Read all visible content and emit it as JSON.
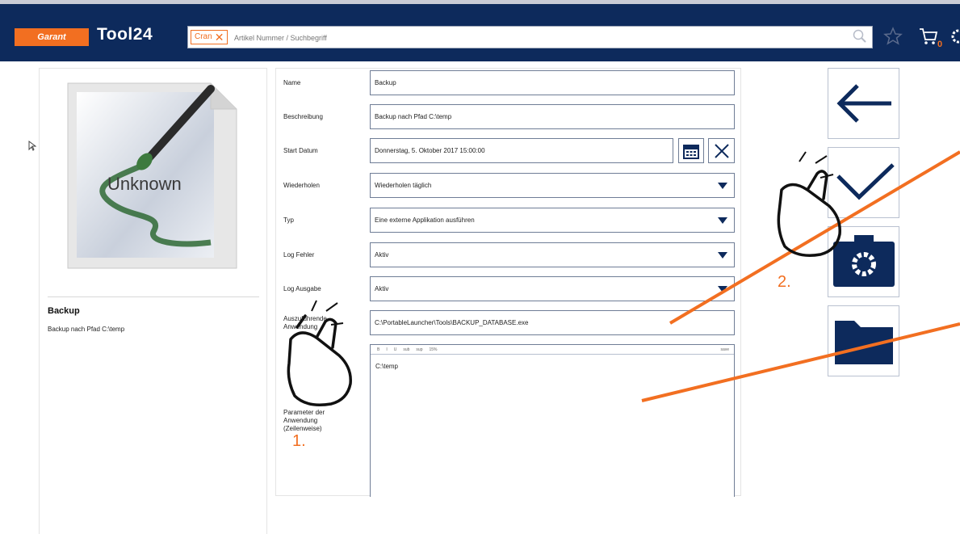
{
  "header": {
    "brand_logo": "Garant",
    "app_name": "Tool24",
    "search_tag": "Cran",
    "search_tag_close": "✕",
    "search_placeholder": "Artikel Nummer / Suchbegriff",
    "cart_count": "0",
    "icons": [
      "search-icon",
      "star-icon",
      "cart-icon",
      "gear-icon"
    ]
  },
  "left_panel": {
    "image_label": "Unknown",
    "title": "Backup",
    "description": "Backup nach Pfad C:\\temp"
  },
  "form": {
    "name": {
      "label": "Name",
      "value": "Backup"
    },
    "beschreibung": {
      "label": "Beschreibung",
      "value": "Backup nach Pfad C:\\temp"
    },
    "start_datum": {
      "label": "Start Datum",
      "value": "Donnerstag, 5. Oktober 2017 15:00:00"
    },
    "wiederholen": {
      "label": "Wiederholen",
      "value": "Wiederholen täglich"
    },
    "typ": {
      "label": "Typ",
      "value": "Eine externe Applikation ausführen"
    },
    "log_fehler": {
      "label": "Log Fehler",
      "value": "Aktiv"
    },
    "log_ausgabe": {
      "label": "Log Ausgabe",
      "value": "Aktiv"
    },
    "anwendung": {
      "label": "Auszuführende Anwendung",
      "value": "C:\\PortableLauncher\\Tools\\BACKUP_DATABASE.exe"
    },
    "parameter": {
      "label": "Parameter der Anwendung (Zeilenweise)",
      "toolbar": [
        "B",
        "I",
        "U",
        "sub",
        "sup",
        "15%"
      ],
      "toolbar_right": "save",
      "value": "C:\\temp"
    }
  },
  "side_actions": [
    "back-arrow-icon",
    "checkmark-icon",
    "camera-settings-icon",
    "folder-icon"
  ],
  "annotations": {
    "step1": "1.",
    "step2": "2.",
    "accent_color": "#f26f21"
  },
  "colors": {
    "header_bg": "#0d2a5c",
    "brand_orange": "#f26f21",
    "button_icon": "#0d2a5c"
  }
}
